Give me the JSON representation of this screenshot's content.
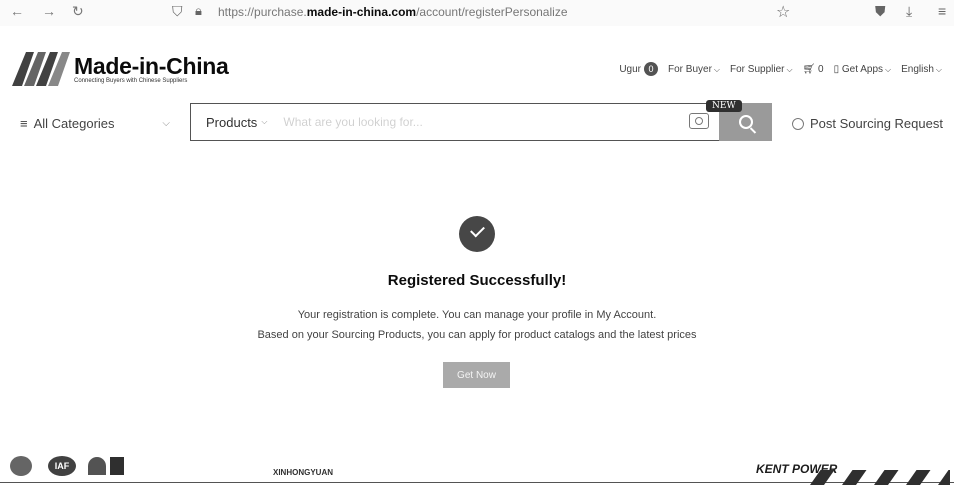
{
  "browser": {
    "url_prefix": "https://purchase.",
    "url_host": "made-in-china.com",
    "url_path": "/account/registerPersonalize"
  },
  "header": {
    "logo_name": "Made-in-China",
    "logo_tagline": "Connecting Buyers with Chinese Suppliers",
    "user_name": "Ugur",
    "user_badge": "0",
    "for_buyer": "For Buyer",
    "for_supplier": "For Supplier",
    "cart_count": "0",
    "get_apps": "Get Apps",
    "language": "English"
  },
  "search": {
    "categories_label": "All Categories",
    "type_label": "Products",
    "placeholder": "What are you looking for...",
    "new_tag": "NEW",
    "post_request": "Post Sourcing Request"
  },
  "main": {
    "title": "Registered Successfully!",
    "message_line1": "Your registration is complete. You can manage your profile in My Account.",
    "message_line2": "Based on your Sourcing Products, you can apply for product catalogs and the latest prices",
    "cta_label": "Get Now"
  },
  "footer": {
    "iaf": "IAF",
    "xinhongyuan": "XINHONGYUAN",
    "kentpower": "KENT POWER"
  },
  "icons": {
    "back": "arrow-left-icon",
    "forward": "arrow-right-icon",
    "reload": "reload-icon",
    "shield": "shield-icon",
    "lock": "lock-icon",
    "bookmark": "star-icon",
    "pocket": "pocket-icon",
    "download": "download-icon",
    "menu": "hamburger-icon",
    "cart": "cart-icon",
    "phone": "phone-icon",
    "camera": "camera-icon",
    "search": "search-icon",
    "sourcing": "sourcing-icon",
    "success": "check-circle-icon"
  }
}
